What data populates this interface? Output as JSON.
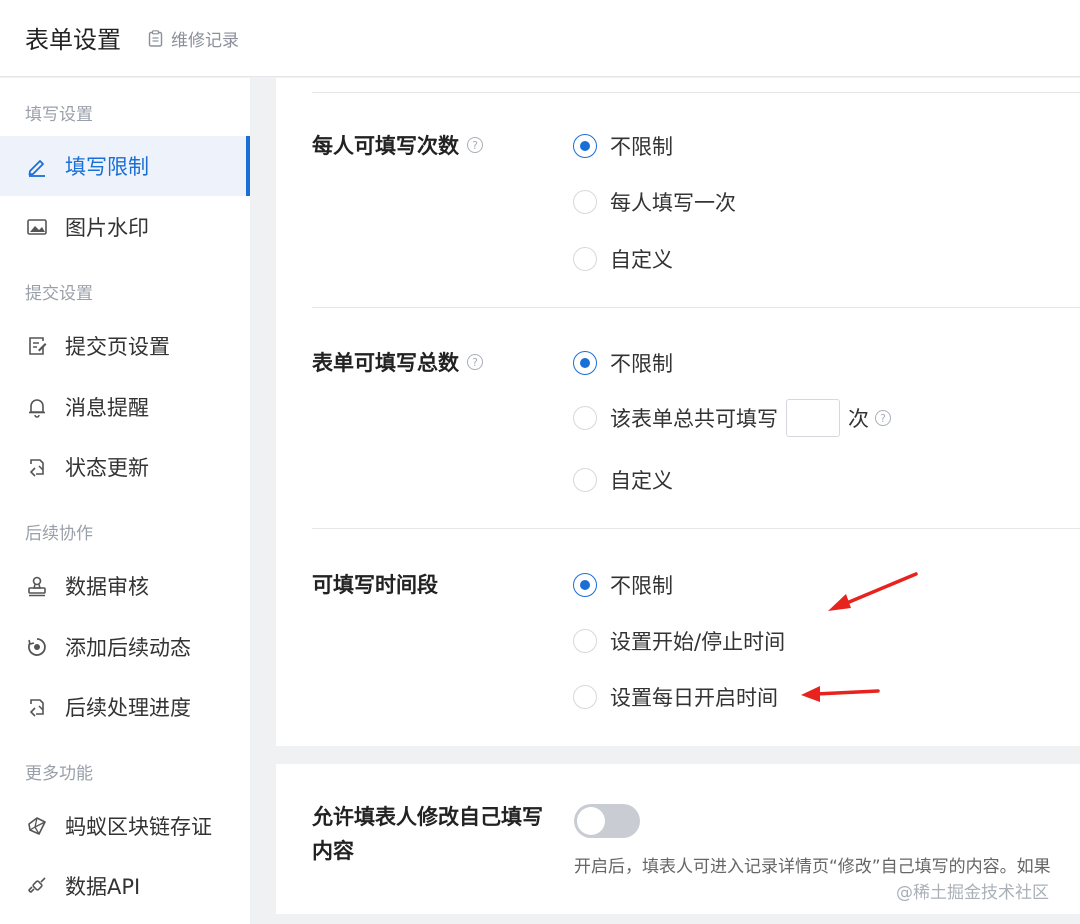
{
  "header": {
    "title": "表单设置",
    "log_label": "维修记录"
  },
  "sidebar": {
    "groups": [
      "填写设置",
      "提交设置",
      "后续协作",
      "更多功能"
    ],
    "items": [
      {
        "label": "填写限制",
        "icon": "pen-icon"
      },
      {
        "label": "图片水印",
        "icon": "image-icon"
      },
      {
        "label": "提交页设置",
        "icon": "document-edit-icon"
      },
      {
        "label": "消息提醒",
        "icon": "bell-icon"
      },
      {
        "label": "状态更新",
        "icon": "sync-icon"
      },
      {
        "label": "数据审核",
        "icon": "stamp-icon"
      },
      {
        "label": "添加后续动态",
        "icon": "dynamic-icon"
      },
      {
        "label": "后续处理进度",
        "icon": "sync-icon"
      },
      {
        "label": "蚂蚁区块链存证",
        "icon": "blockchain-icon"
      },
      {
        "label": "数据API",
        "icon": "api-icon"
      }
    ],
    "active_item": "填写限制"
  },
  "fill_limit": {
    "label": "每人可填写次数",
    "options": [
      "不限制",
      "每人填写一次",
      "自定义"
    ],
    "selected": "不限制"
  },
  "total_limit": {
    "label": "表单可填写总数",
    "options": [
      "不限制",
      "该表单总共可填写",
      "自定义"
    ],
    "unit": "次",
    "input_value": "",
    "selected": "不限制"
  },
  "time_limit": {
    "label": "可填写时间段",
    "options": [
      "不限制",
      "设置开始/停止时间",
      "设置每日开启时间"
    ],
    "selected": "不限制"
  },
  "allow_edit": {
    "label": "允许填表人修改自己填写内容",
    "enabled": false,
    "hint": "开启后，填表人可进入记录详情页“修改”自己填写的内容。如果"
  },
  "watermark": "@稀土掘金技术社区",
  "colors": {
    "accent": "#1a6fd6",
    "annotation_arrow": "#e8231e"
  }
}
